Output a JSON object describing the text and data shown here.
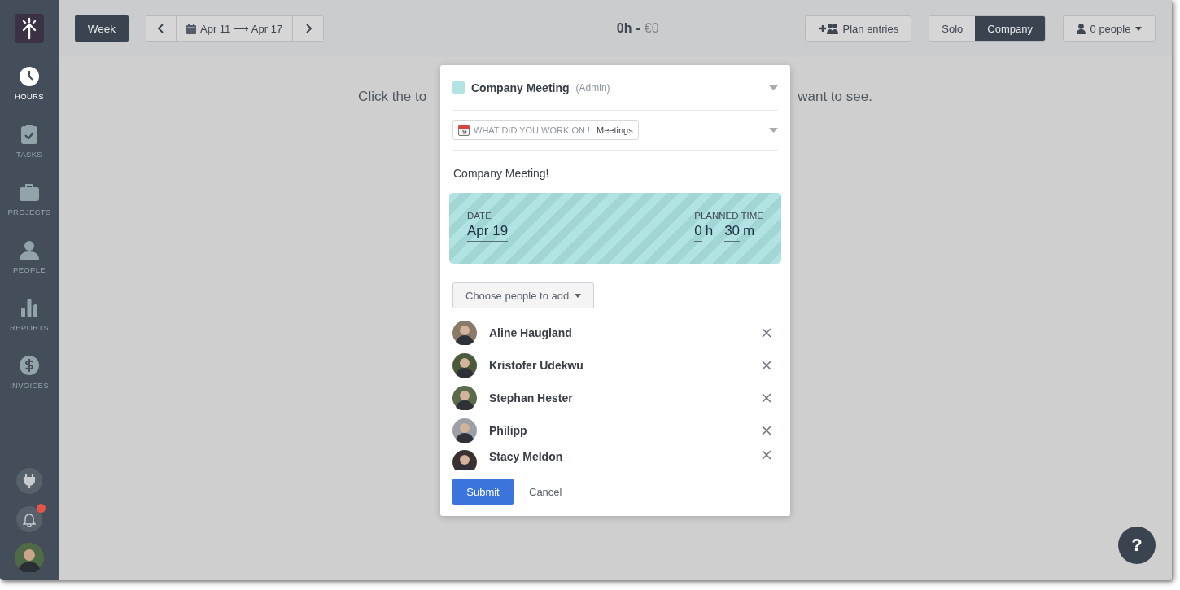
{
  "sidebar": {
    "nav": [
      {
        "label": "HOURS",
        "kind": "clock",
        "selected": true
      },
      {
        "label": "TASKS",
        "kind": "tasks",
        "selected": false
      },
      {
        "label": "PROJECTS",
        "kind": "briefcase",
        "selected": false
      },
      {
        "label": "PEOPLE",
        "kind": "person",
        "selected": false
      },
      {
        "label": "REPORTS",
        "kind": "bars",
        "selected": false
      },
      {
        "label": "INVOICES",
        "kind": "dollar",
        "selected": false
      }
    ],
    "notifications_unread": true
  },
  "toolbar": {
    "view_button": "Week",
    "date_range": "Apr 11 ⟶ Apr 17",
    "total_hours": "0h",
    "separator": "-",
    "total_amount": "€0",
    "plan_button": "Plan entries",
    "mode_toggle": [
      {
        "label": "Solo",
        "selected": false
      },
      {
        "label": "Company",
        "selected": true
      }
    ],
    "people_filter": "0 people"
  },
  "background_hint": {
    "left": "Click the to",
    "right": "want to see."
  },
  "modal": {
    "project": {
      "name": "Company Meeting",
      "client": "(Admin)",
      "color": "#b0e3e1"
    },
    "task": {
      "label": "WHAT DID YOU WORK ON !:",
      "value": "Meetings"
    },
    "description": "Company Meeting!",
    "date_label": "DATE",
    "date": "Apr 19",
    "time_label": "PLANNED TIME",
    "hours": "0",
    "hours_unit": "h",
    "minutes": "30",
    "minutes_unit": "m",
    "choose_people": "Choose people to add",
    "people": [
      {
        "name": "Aline Haugland"
      },
      {
        "name": "Kristofer Udekwu"
      },
      {
        "name": "Stephan Hester"
      },
      {
        "name": "Philipp"
      },
      {
        "name": "Stacy Meldon"
      }
    ],
    "submit": "Submit",
    "cancel": "Cancel"
  },
  "help_button": "?"
}
